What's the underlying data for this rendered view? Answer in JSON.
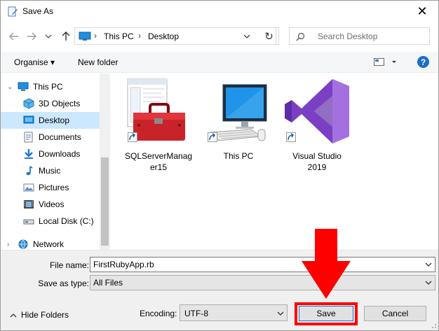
{
  "window": {
    "title": "Save As",
    "close": "✕"
  },
  "address": {
    "segments": [
      "This PC",
      "Desktop"
    ],
    "refresh": "↻"
  },
  "search": {
    "placeholder": "Search Desktop"
  },
  "toolbar": {
    "organise": "Organise ▾",
    "new_folder": "New folder",
    "help": "?"
  },
  "navpane": {
    "items": [
      {
        "label": "This PC",
        "icon": "computer-icon",
        "level": 0
      },
      {
        "label": "3D Objects",
        "icon": "cube-icon",
        "level": 1
      },
      {
        "label": "Desktop",
        "icon": "desktop-icon",
        "level": 1,
        "selected": true
      },
      {
        "label": "Documents",
        "icon": "documents-icon",
        "level": 1
      },
      {
        "label": "Downloads",
        "icon": "download-icon",
        "level": 1
      },
      {
        "label": "Music",
        "icon": "music-icon",
        "level": 1
      },
      {
        "label": "Pictures",
        "icon": "pictures-icon",
        "level": 1
      },
      {
        "label": "Videos",
        "icon": "video-icon",
        "level": 1
      },
      {
        "label": "Local Disk (C:)",
        "icon": "drive-icon",
        "level": 1
      },
      {
        "label": "Network",
        "icon": "network-icon",
        "level": 0
      }
    ]
  },
  "files": [
    {
      "label": "SQLServerManag er15",
      "icon": "toolbox-icon"
    },
    {
      "label": "This PC",
      "icon": "computer-icon"
    },
    {
      "label": "Visual Studio 2019",
      "icon": "visual-studio-icon"
    }
  ],
  "form": {
    "file_name_label": "File name:",
    "file_name_value": "FirstRubyApp.rb",
    "save_as_type_label": "Save as type:",
    "save_as_type_value": "All Files",
    "hide_folders": "Hide Folders",
    "encoding_label": "Encoding:",
    "encoding_value": "UTF-8",
    "save": "Save",
    "cancel": "Cancel"
  },
  "colors": {
    "accent": "#0078d7",
    "selection": "#cce8ff",
    "highlight": "#ff0000"
  }
}
